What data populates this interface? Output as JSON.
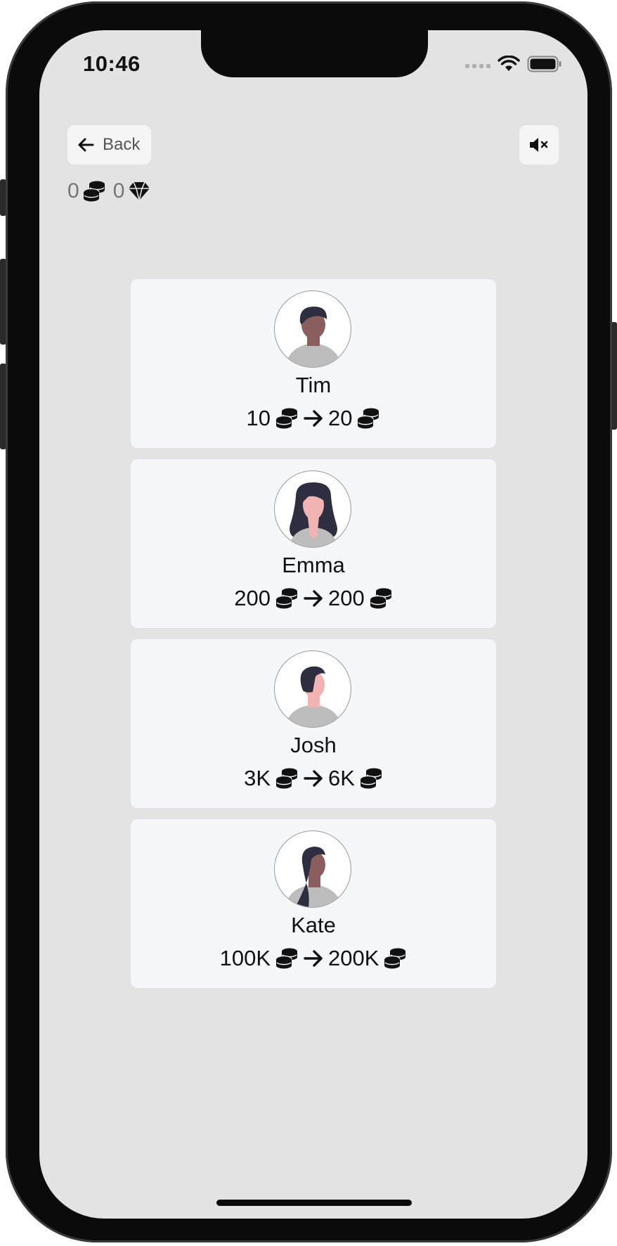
{
  "status_bar": {
    "time": "10:46"
  },
  "header": {
    "back_label": "Back"
  },
  "balance": {
    "coins": "0",
    "gems": "0"
  },
  "opponents": [
    {
      "name": "Tim",
      "entry": "10",
      "reward": "20",
      "avatar": "man-short-hair-avatar"
    },
    {
      "name": "Emma",
      "entry": "200",
      "reward": "200",
      "avatar": "woman-long-hair-avatar"
    },
    {
      "name": "Josh",
      "entry": "3K",
      "reward": "6K",
      "avatar": "man-side-part-avatar"
    },
    {
      "name": "Kate",
      "entry": "100K",
      "reward": "200K",
      "avatar": "woman-ponytail-avatar"
    }
  ],
  "colors": {
    "screen_bg": "#e3e3e3",
    "card_bg": "#f6f7f9",
    "button_bg": "#f5f5f5",
    "text": "#111111"
  },
  "icons": [
    "arrow-left-icon",
    "volume-mute-icon",
    "coins-icon",
    "gem-icon",
    "arrow-right-icon",
    "wifi-icon",
    "battery-icon"
  ]
}
